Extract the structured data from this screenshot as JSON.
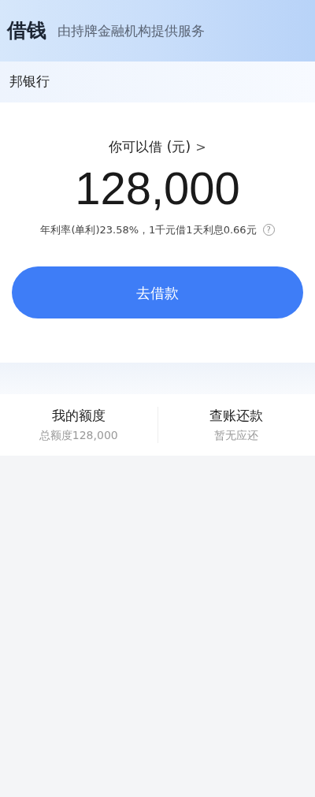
{
  "header": {
    "title": "借钱",
    "subtitle": "由持牌金融机构提供服务"
  },
  "bank": {
    "name": "邦银行"
  },
  "loan": {
    "label": "你可以借 (元)",
    "chevron": ">",
    "amount": "128,000",
    "rate": "年利率(单利)23.58%，1千元借1天利息0.66元",
    "help": "?",
    "button": "去借款"
  },
  "shortcuts": [
    {
      "title": "我的额度",
      "subtitle": "总额度128,000"
    },
    {
      "title": "查账还款",
      "subtitle": "暂无应还"
    }
  ]
}
